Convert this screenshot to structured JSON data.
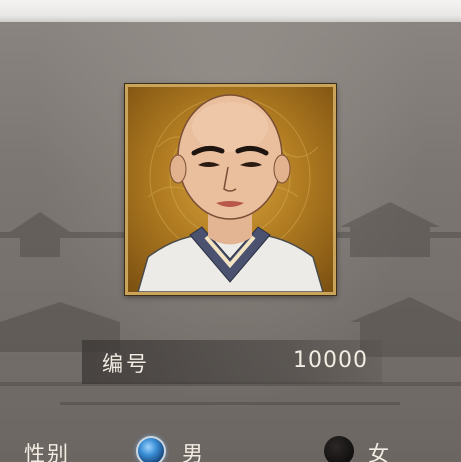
{
  "character": {
    "id_label": "编号",
    "id_value": "10000",
    "gender_label": "性别",
    "gender_options": [
      "男",
      "女"
    ],
    "selected_gender": "男"
  },
  "icons": {
    "portrait": "monk-portrait",
    "male_radio": "radio-selected-icon",
    "female_radio": "radio-unselected-icon"
  },
  "colors": {
    "frame_gold": "#c9a45a",
    "panel_bg": "#7c7672",
    "text": "#f2ece2",
    "radio_selected": "#3b8fd6"
  }
}
